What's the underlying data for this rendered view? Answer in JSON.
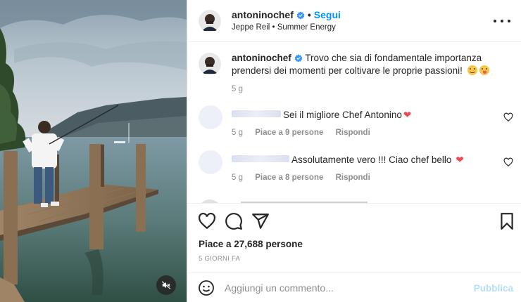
{
  "post": {
    "username": "antoninochef",
    "follow_label": "Segui",
    "audio_label": "Jeppe Reil • Summer Energy",
    "caption_text": "Trovo che sia di fondamentale importanza prendersi dei momenti per coltivare le proprie passioni!",
    "caption_time": "5 g"
  },
  "comments": [
    {
      "text": "Sei il migliore Chef Antonino",
      "time": "5 g",
      "likes": "Piace a 9 persone",
      "reply": "Rispondi"
    },
    {
      "text": "Assolutamente vero !!! Ciao chef bello",
      "time": "5 g",
      "likes": "Piace a 8 persone",
      "reply": "Rispondi"
    }
  ],
  "stats": {
    "likes": "Piace a 27,688 persone",
    "date": "5 GIORNI FA"
  },
  "comment_bar": {
    "placeholder": "Aggiungi un commento...",
    "publish_label": "Pubblica"
  },
  "icons": {
    "verified": "verified-badge-icon",
    "more": "more-options-icon",
    "like": "heart-icon",
    "comment": "comment-icon",
    "share": "share-icon",
    "save": "bookmark-icon",
    "emoji": "emoji-icon",
    "mute": "muted-speaker-icon"
  },
  "colors": {
    "accent": "#0095f6",
    "heart_red": "#ed4956",
    "verified": "#3897f0"
  }
}
